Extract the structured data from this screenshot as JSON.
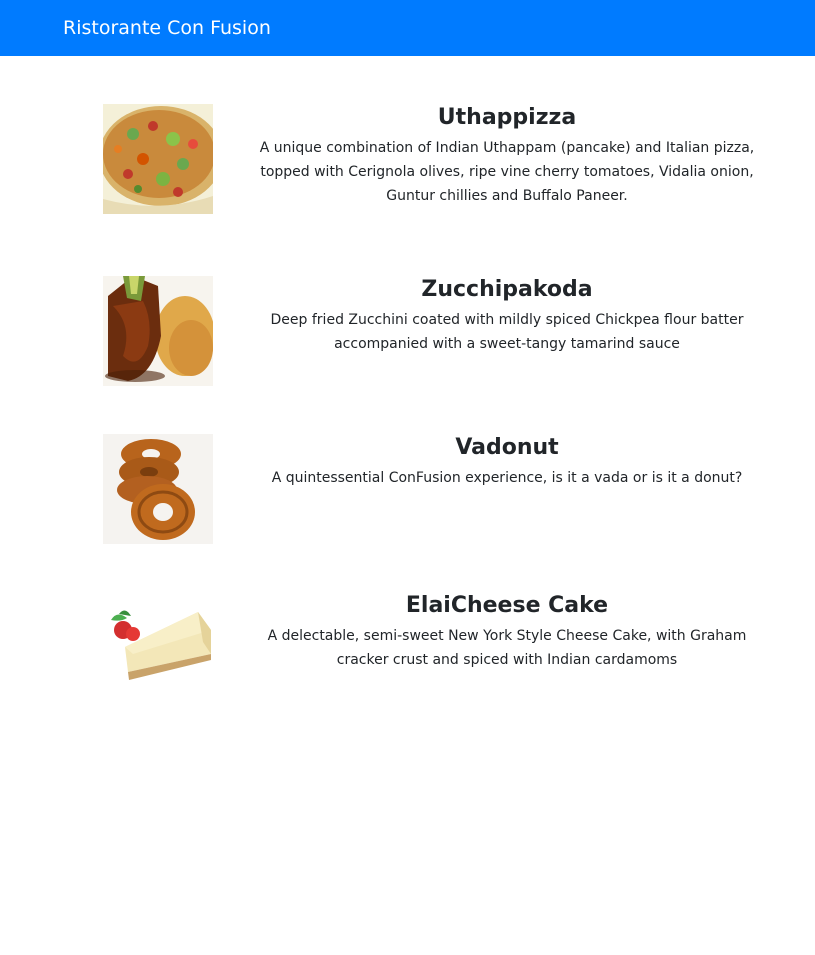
{
  "navbar": {
    "brand": "Ristorante Con Fusion",
    "color": "#007bff"
  },
  "dishes": [
    {
      "name": "Uthappizza",
      "description": "A unique combination of Indian Uthappam (pancake) and Italian pizza, topped with Cerignola olives, ripe vine cherry tomatoes, Vidalia onion, Guntur chillies and Buffalo Paneer.",
      "image": "uthappizza-photo"
    },
    {
      "name": "Zucchipakoda",
      "description": "Deep fried Zucchini coated with mildly spiced Chickpea flour batter accompanied with a sweet-tangy tamarind sauce",
      "image": "zucchipakoda-photo"
    },
    {
      "name": "Vadonut",
      "description": "A quintessential ConFusion experience, is it a vada or is it a donut?",
      "image": "vadonut-photo"
    },
    {
      "name": "ElaiCheese Cake",
      "description": "A delectable, semi-sweet New York Style Cheese Cake, with Graham cracker crust and spiced with Indian cardamoms",
      "image": "elaicheese-cake-photo"
    }
  ]
}
